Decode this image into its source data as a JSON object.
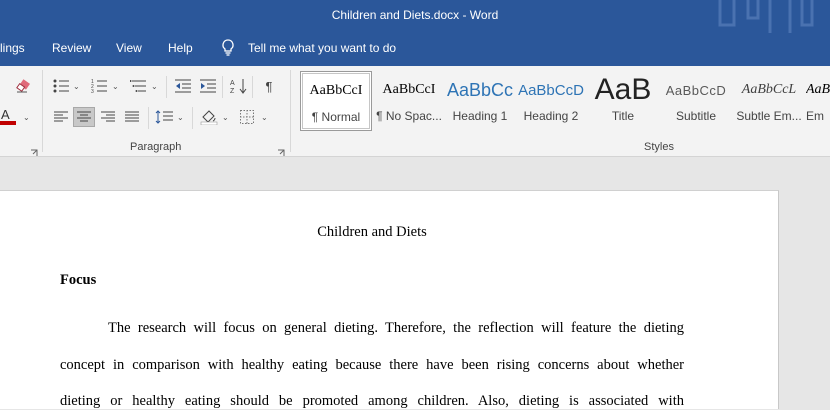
{
  "window": {
    "title": "Children and Diets.docx  -  Word"
  },
  "tabs": [
    "lings",
    "Review",
    "View",
    "Help"
  ],
  "tell_me": {
    "label": "Tell me what you want to do"
  },
  "groups": {
    "paragraph": "Paragraph",
    "styles": "Styles"
  },
  "styles": [
    {
      "sample": "AaBbCcI",
      "name": "¶ Normal"
    },
    {
      "sample": "AaBbCcI",
      "name": "¶ No Spac..."
    },
    {
      "sample": "AaBbCc",
      "name": "Heading 1"
    },
    {
      "sample": "AaBbCcD",
      "name": "Heading 2"
    },
    {
      "sample": "AaB",
      "name": "Title"
    },
    {
      "sample": "AaBbCcD",
      "name": "Subtitle"
    },
    {
      "sample": "AaBbCcL",
      "name": "Subtle Em..."
    },
    {
      "sample": "AaBl",
      "name": "Em"
    }
  ],
  "document": {
    "title": "Children and Diets",
    "heading": "Focus",
    "paragraph_lines": [
      "The research will focus on general dieting. Therefore, the reflection will feature the dieting",
      "concept in comparison with healthy eating because there have been rising concerns about whether",
      "dieting or healthy eating should be promoted among children. Also, dieting is associated with"
    ]
  },
  "colors": {
    "titlebar": "#2b579a",
    "ribbon": "#f3f3f3",
    "font_color_bar": "#c00000"
  }
}
